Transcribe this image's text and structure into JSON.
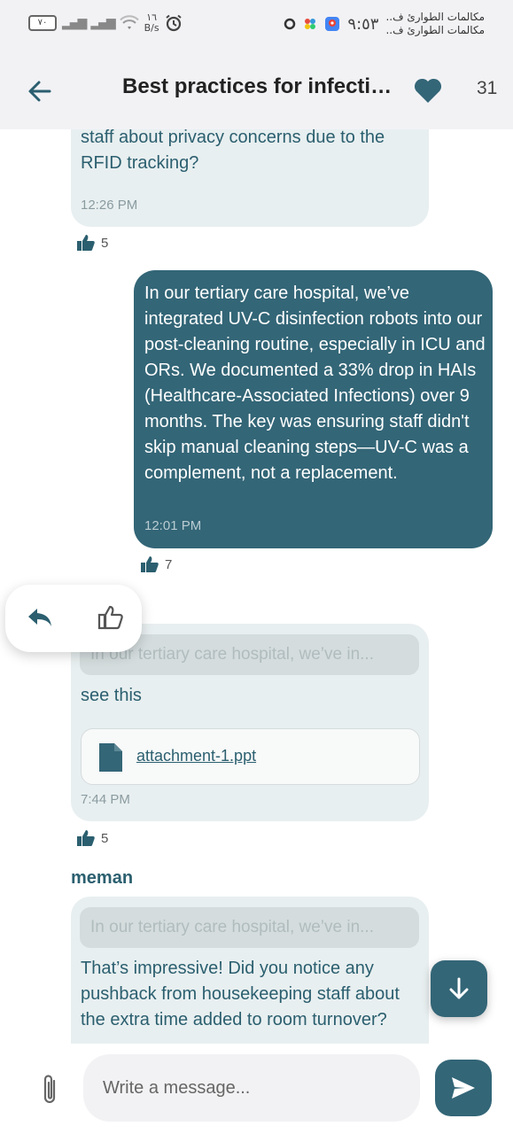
{
  "status_bar": {
    "battery": "٧٠",
    "net_speed_value": "١٦",
    "net_speed_unit": "B/s",
    "time": "٩:٥٣",
    "notifications": [
      "مكالمات الطوارئ ف..",
      "مكالمات الطوارئ ف.."
    ]
  },
  "header": {
    "title": "Best practices for infection control",
    "likes": "31"
  },
  "messages": [
    {
      "text": "interesting approach. Any pushback from staff about privacy concerns due to the RFID tracking?",
      "time": "12:26 PM",
      "reactions": "5"
    },
    {
      "text": "In our tertiary care hospital, we’ve integrated UV-C disinfection robots into our post-cleaning routine, especially in ICU and ORs. We documented a 33% drop in HAIs (Healthcare-Associated Infections) over 9 months.  The key was ensuring staff didn't skip manual cleaning steps—UV-C was a complement, not a replacement.",
      "time": "12:01 PM",
      "reactions": "7"
    },
    {
      "quote": "In our tertiary care hospital, we’ve in...",
      "text": "see this",
      "attachment": "attachment-1.ppt",
      "time": "7:44 PM",
      "reactions": "5"
    },
    {
      "sender": "meman",
      "quote": "In our tertiary care hospital, we’ve in...",
      "text": "That’s impressive! Did you notice any pushback from housekeeping staff about the extra time added to room turnover?"
    }
  ],
  "composer": {
    "placeholder": "Write a message..."
  },
  "icons": {
    "back": "arrow-left-icon",
    "heart": "heart-icon",
    "thumb": "thumbs-up-icon",
    "reply": "reply-icon",
    "like_outline": "thumbs-up-outline-icon",
    "file": "file-icon",
    "scroll_down": "arrow-down-icon",
    "attach": "paperclip-icon",
    "send": "send-icon"
  },
  "colors": {
    "accent": "#336677",
    "incoming_bubble": "#e8eff0",
    "header_bg": "#f2f2f5"
  }
}
